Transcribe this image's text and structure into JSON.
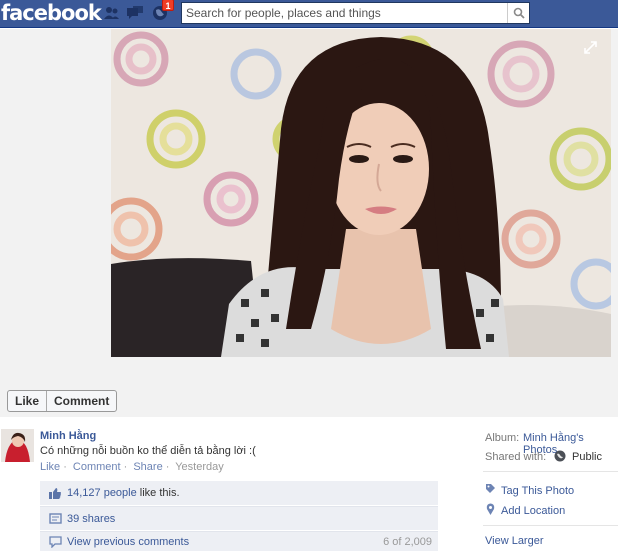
{
  "header": {
    "logo_text": "facebook",
    "search_placeholder": "Search for people, places and things",
    "notification_count": "1",
    "brand_color": "#3b5998"
  },
  "photo_actions": {
    "like_label": "Like",
    "comment_label": "Comment"
  },
  "post": {
    "author": "Minh Hằng",
    "caption": "Có những nỗi buồn ko thể diễn tả bằng lời :(",
    "actions": [
      "Like",
      "Comment",
      "Share"
    ],
    "timestamp": "Yesterday",
    "likes_count_link": "14,127 people",
    "likes_suffix": " like this.",
    "shares_label": "39 shares",
    "view_previous_label": "View previous comments",
    "comments_count": "6 of 2,009"
  },
  "sidebar": {
    "album_label": "Album:",
    "album_name": "Minh Hằng's Photos",
    "shared_label": "Shared with:",
    "privacy": "Public",
    "tag_photo": "Tag This Photo",
    "add_location": "Add Location",
    "view_larger": "View Larger"
  },
  "icons": {
    "friends": "friend-requests-icon",
    "messages": "messages-icon",
    "notifications": "globe-icon",
    "search": "search-icon",
    "expand": "expand-icon",
    "like": "thumbs-up-icon",
    "share": "share-icon",
    "comments": "comment-icon",
    "globe": "public-globe-icon",
    "tag": "tag-icon",
    "location": "pin-icon"
  }
}
